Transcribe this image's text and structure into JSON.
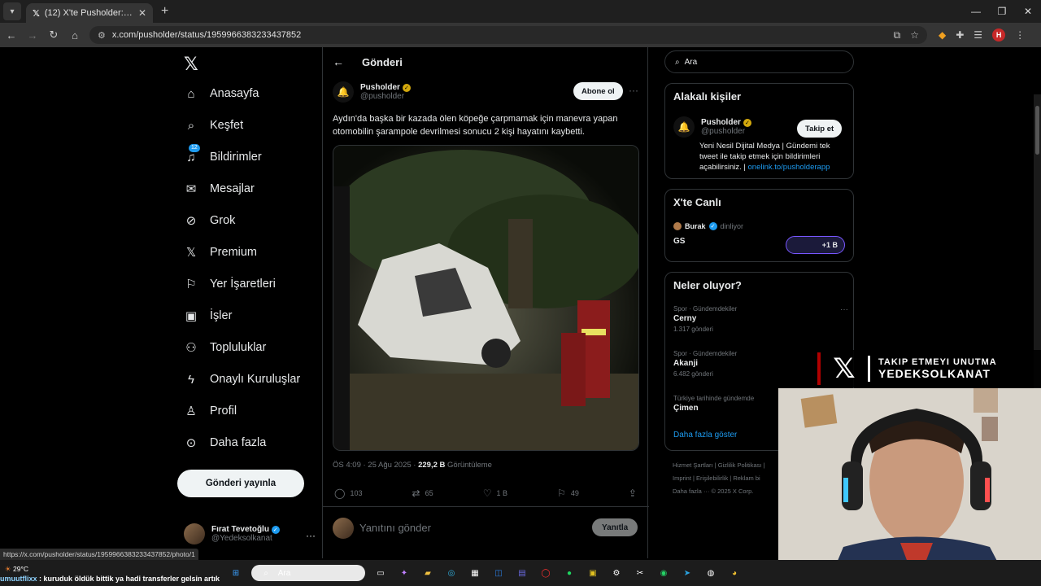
{
  "browser": {
    "tab_title": "(12) X'te Pusholder: \"Aydın'da b",
    "url": "x.com/pusholder/status/1959966383233437852",
    "new_tab": "+",
    "profile_letter": "H"
  },
  "nav": {
    "items": [
      {
        "label": "Anasayfa",
        "icon": "home-icon"
      },
      {
        "label": "Keşfet",
        "icon": "search-icon"
      },
      {
        "label": "Bildirimler",
        "icon": "bell-icon",
        "badge": "12"
      },
      {
        "label": "Mesajlar",
        "icon": "mail-icon"
      },
      {
        "label": "Grok",
        "icon": "grok-icon"
      },
      {
        "label": "Premium",
        "icon": "x-logo-icon"
      },
      {
        "label": "Yer İşaretleri",
        "icon": "bookmark-icon"
      },
      {
        "label": "İşler",
        "icon": "briefcase-icon"
      },
      {
        "label": "Topluluklar",
        "icon": "people-icon"
      },
      {
        "label": "Onaylı Kuruluşlar",
        "icon": "lightning-icon"
      },
      {
        "label": "Profil",
        "icon": "person-icon"
      },
      {
        "label": "Daha fazla",
        "icon": "more-circle-icon"
      }
    ],
    "post_button": "Gönderi yayınla",
    "me": {
      "name": "Fırat Tevetoğlu",
      "handle": "@Yedeksolkanat"
    }
  },
  "main": {
    "header": "Gönderi",
    "author": {
      "name": "Pusholder",
      "handle": "@pusholder"
    },
    "subscribe": "Abone ol",
    "text": "Aydın'da başka bir kazada ölen köpeğe çarpmamak için manevra yapan otomobilin şarampole devrilmesi sonucu 2 kişi hayatını kaybetti.",
    "meta": {
      "time": "ÖS 4:09 · 25 Ağu 2025 · ",
      "views": "229,2 B",
      "views_label": " Görüntüleme"
    },
    "actions": {
      "replies": "103",
      "reposts": "65",
      "likes": "1 B",
      "bookmarks": "49"
    },
    "reply_placeholder": "Yanıtını gönder",
    "reply_button": "Yanıtla"
  },
  "right": {
    "search_placeholder": "Ara",
    "relevant": {
      "title": "Alakalı kişiler",
      "name": "Pusholder",
      "handle": "@pusholder",
      "follow": "Takip et",
      "bio": "Yeni Nesil Dijital Medya | Gündemi tek tweet ile takip etmek için bildirimleri açabilirsiniz. | ",
      "bio_link": "onelink.to/pusholderapp"
    },
    "live": {
      "title": "X'te Canlı",
      "host": "Burak",
      "status": "dinliyor",
      "topic": "GS",
      "listeners": "+1 B"
    },
    "trends": {
      "title": "Neler oluyor?",
      "items": [
        {
          "category": "Spor · Gündemdekiler",
          "name": "Cerny",
          "count": "1.317 gönderi"
        },
        {
          "category": "Spor · Gündemdekiler",
          "name": "Akanji",
          "count": "6.482 gönderi"
        },
        {
          "category": "Türkiye tarihinde gündemde",
          "name": "Çimen",
          "count": ""
        }
      ],
      "show_more": "Daha fazla göster"
    },
    "footer": {
      "line1": "Hizmet Şartları  |  Gizlilik Politikası  |",
      "line2": "Imprint  |  Erişilebilirlik  |  Reklam bi",
      "line3": "Daha fazla ···  © 2025 X Corp."
    }
  },
  "overlay": {
    "status_url": "https://x.com/pusholder/status/1959966383233437852/photo/1",
    "weather": "29°C",
    "ticker_user": "umuutflixx",
    "ticker_text": " : kuruduk öldük bittik ya hadi transferler gelsin artık",
    "taskbar_search": "Ara",
    "watermark_line1": "TAKIP ETMEYI UNUTMA",
    "watermark_line2": "YEDEKSOLKANAT"
  },
  "colors": {
    "accent": "#1d9bf0",
    "gold_badge": "#d4a90d",
    "background": "#000000"
  }
}
